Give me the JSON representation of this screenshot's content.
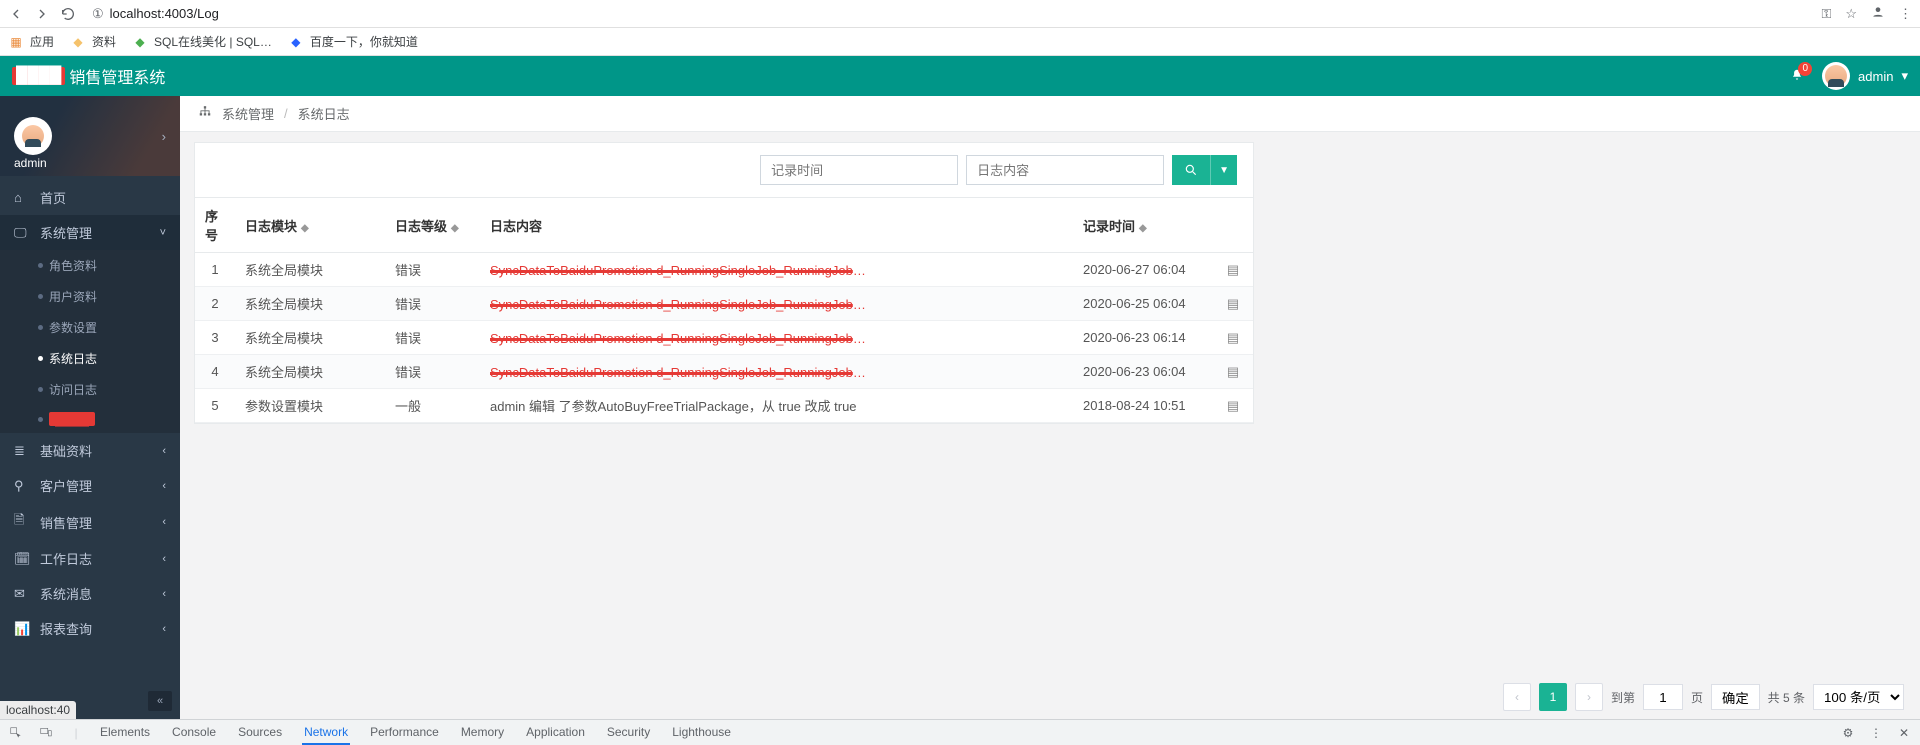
{
  "browser": {
    "url_info": "①",
    "url_host": "localhost:4003",
    "url_path": "/Log",
    "bookmarks_apps_label": "应用",
    "bookmarks": [
      {
        "label": "资料",
        "color": "#f5c26b"
      },
      {
        "label": "SQL在线美化 | SQL…",
        "color": "#4caf50"
      },
      {
        "label": "百度一下，你就知道",
        "color": "#2962ff"
      }
    ],
    "status_text": "localhost:40"
  },
  "header": {
    "brand_masked": "████",
    "brand_rest": "销售管理系统",
    "notif_count": "0",
    "username": "admin",
    "caret": "▾"
  },
  "sidebar": {
    "username": "admin",
    "caret": "›",
    "menu": [
      {
        "icon": "home",
        "label": "首页",
        "expandable": false
      },
      {
        "icon": "desktop",
        "label": "系统管理",
        "expandable": true,
        "open": true,
        "children": [
          {
            "label": "角色资料",
            "current": false
          },
          {
            "label": "用户资料",
            "current": false
          },
          {
            "label": "参数设置",
            "current": false
          },
          {
            "label": "系统日志",
            "current": true
          },
          {
            "label": "访问日志",
            "current": false
          },
          {
            "label": "████",
            "current": false,
            "red": true
          }
        ]
      },
      {
        "icon": "layers",
        "label": "基础资料",
        "expandable": true
      },
      {
        "icon": "users",
        "label": "客户管理",
        "expandable": true
      },
      {
        "icon": "file",
        "label": "销售管理",
        "expandable": true
      },
      {
        "icon": "calendar",
        "label": "工作日志",
        "expandable": true
      },
      {
        "icon": "chat",
        "label": "系统消息",
        "expandable": true
      },
      {
        "icon": "chart",
        "label": "报表查询",
        "expandable": true
      }
    ],
    "collapse_glyph": "«"
  },
  "breadcrumb": {
    "seg1": "系统管理",
    "seg2": "系统日志",
    "sep": "/"
  },
  "filters": {
    "time_placeholder": "记录时间",
    "content_placeholder": "日志内容"
  },
  "table": {
    "headers": {
      "idx": "序号",
      "mod": "日志模块",
      "lvl": "日志等级",
      "content": "日志内容",
      "time": "记录时间"
    },
    "rows": [
      {
        "idx": "1",
        "mod": "系统全局模块",
        "lvl": "错误",
        "content": "SyncDataToBaiduPromotion d_RunningSingleJob_RunningJobEvent发生…",
        "time": "2020-06-27 06:04",
        "red": true
      },
      {
        "idx": "2",
        "mod": "系统全局模块",
        "lvl": "错误",
        "content": "SyncDataToBaiduPromotion d_RunningSingleJob_RunningJobEvent发生…",
        "time": "2020-06-25 06:04",
        "red": true
      },
      {
        "idx": "3",
        "mod": "系统全局模块",
        "lvl": "错误",
        "content": "SyncDataToBaiduPromotion d_RunningSingleJob_RunningJobEvent发生…",
        "time": "2020-06-23 06:14",
        "red": true
      },
      {
        "idx": "4",
        "mod": "系统全局模块",
        "lvl": "错误",
        "content": "SyncDataToBaiduPromotion d_RunningSingleJob_RunningJobEvent发生…",
        "time": "2020-06-23 06:04",
        "red": true
      },
      {
        "idx": "5",
        "mod": "参数设置模块",
        "lvl": "一般",
        "content": "admin 编辑 了参数AutoBuyFreeTrialPackage，从 true 改成 true",
        "time": "2018-08-24 10:51",
        "red": false
      }
    ]
  },
  "pager": {
    "goto_label": "到第",
    "page_label": "页",
    "confirm_label": "确定",
    "total_label": "共 5 条",
    "current": "1",
    "goto_value": "1",
    "size_label": "100 条/页"
  },
  "devtools": {
    "tabs": [
      "Elements",
      "Console",
      "Sources",
      "Network",
      "Performance",
      "Memory",
      "Application",
      "Security",
      "Lighthouse"
    ],
    "active": "Network"
  }
}
